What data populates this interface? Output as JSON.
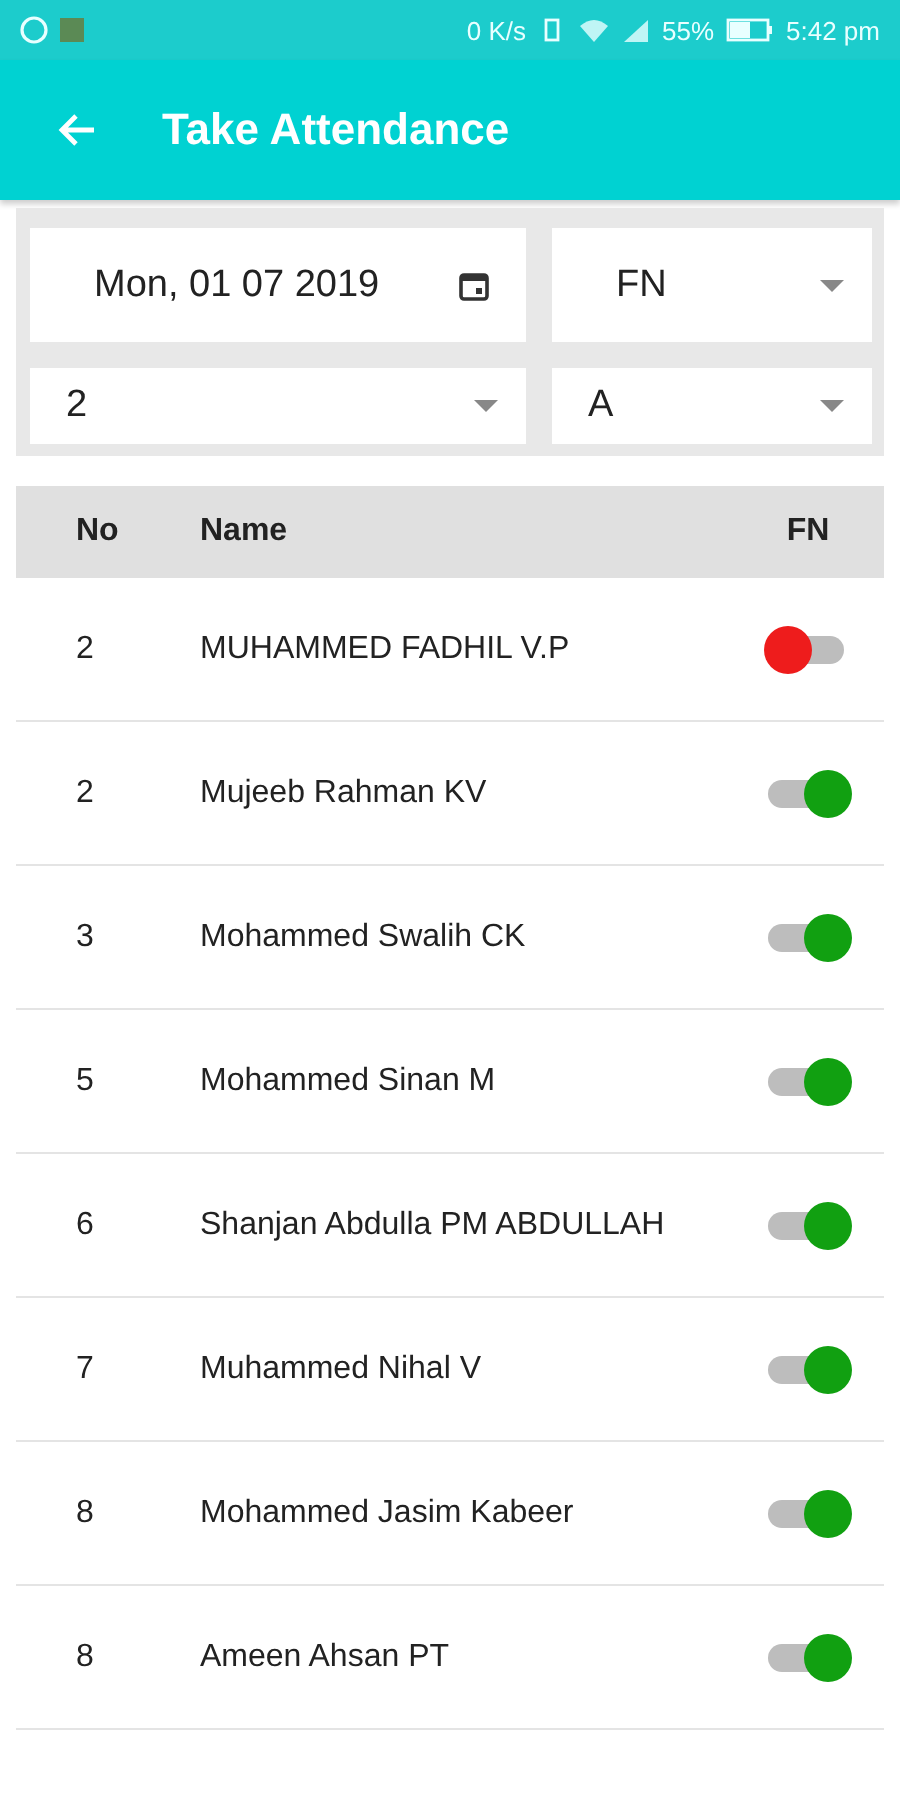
{
  "status_bar": {
    "speed": "0 K/s",
    "battery": "55%",
    "time": "5:42 pm"
  },
  "app_bar": {
    "title": "Take Attendance"
  },
  "filters": {
    "date": "Mon, 01 07 2019",
    "session": "FN",
    "class": "2",
    "division": "A"
  },
  "table": {
    "columns": [
      "No",
      "Name",
      "FN"
    ],
    "rows": [
      {
        "no": "2",
        "name": "MUHAMMED FADHIL V.P",
        "on": false
      },
      {
        "no": "2",
        "name": "Mujeeb Rahman KV",
        "on": true
      },
      {
        "no": "3",
        "name": "Mohammed Swalih CK",
        "on": true
      },
      {
        "no": "5",
        "name": "Mohammed Sinan M",
        "on": true
      },
      {
        "no": "6",
        "name": "Shanjan Abdulla PM ABDULLAH",
        "on": true
      },
      {
        "no": "7",
        "name": "Muhammed Nihal V",
        "on": true
      },
      {
        "no": "8",
        "name": "Mohammed Jasim Kabeer",
        "on": true
      },
      {
        "no": "8",
        "name": "Ameen Ahsan PT",
        "on": true
      }
    ]
  }
}
